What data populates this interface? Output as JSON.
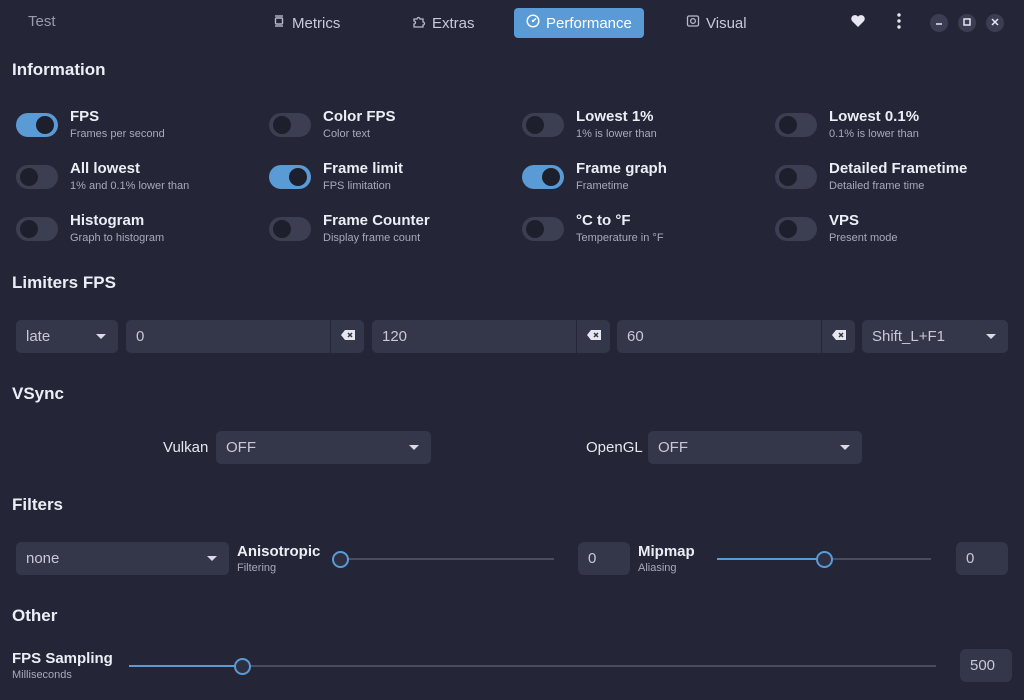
{
  "header": {
    "app_title": "Test",
    "tabs": [
      {
        "label": "Metrics",
        "icon": "metrics-icon"
      },
      {
        "label": "Extras",
        "icon": "puzzle-icon"
      },
      {
        "label": "Performance",
        "icon": "gauge-icon"
      },
      {
        "label": "Visual",
        "icon": "visual-icon"
      }
    ],
    "active_tab": "Performance",
    "accent_color": "#5a9bd5"
  },
  "information": {
    "title": "Information",
    "toggles": [
      {
        "title": "FPS",
        "subtitle": "Frames per second",
        "on": true
      },
      {
        "title": "Color FPS",
        "subtitle": "Color text",
        "on": false
      },
      {
        "title": "Lowest 1%",
        "subtitle": "1% is lower than",
        "on": false
      },
      {
        "title": "Lowest 0.1%",
        "subtitle": "0.1% is lower than",
        "on": false
      },
      {
        "title": "All lowest",
        "subtitle": "1% and 0.1% lower than",
        "on": false
      },
      {
        "title": "Frame limit",
        "subtitle": "FPS limitation",
        "on": true
      },
      {
        "title": "Frame graph",
        "subtitle": "Frametime",
        "on": true
      },
      {
        "title": "Detailed Frametime",
        "subtitle": "Detailed frame time",
        "on": false
      },
      {
        "title": "Histogram",
        "subtitle": "Graph to histogram",
        "on": false
      },
      {
        "title": "Frame Counter",
        "subtitle": "Display frame count",
        "on": false
      },
      {
        "title": "°C to °F",
        "subtitle": "Temperature in °F",
        "on": false
      },
      {
        "title": "VPS",
        "subtitle": "Present mode",
        "on": false
      }
    ]
  },
  "limiters": {
    "title": "Limiters FPS",
    "mode": "late",
    "values": [
      "0",
      "120",
      "60"
    ],
    "hotkey": "Shift_L+F1"
  },
  "vsync": {
    "title": "VSync",
    "vulkan_label": "Vulkan",
    "vulkan_value": "OFF",
    "opengl_label": "OpenGL",
    "opengl_value": "OFF"
  },
  "filters": {
    "title": "Filters",
    "filter_value": "none",
    "anisotropic": {
      "title": "Anisotropic",
      "subtitle": "Filtering",
      "value": "0",
      "level": 0.0
    },
    "mipmap": {
      "title": "Mipmap",
      "subtitle": "Aliasing",
      "value": "0",
      "level": 0.5
    }
  },
  "other": {
    "title": "Other",
    "fps_sampling": {
      "title": "FPS Sampling",
      "subtitle": "Milliseconds",
      "value": "500",
      "level": 0.14
    }
  }
}
